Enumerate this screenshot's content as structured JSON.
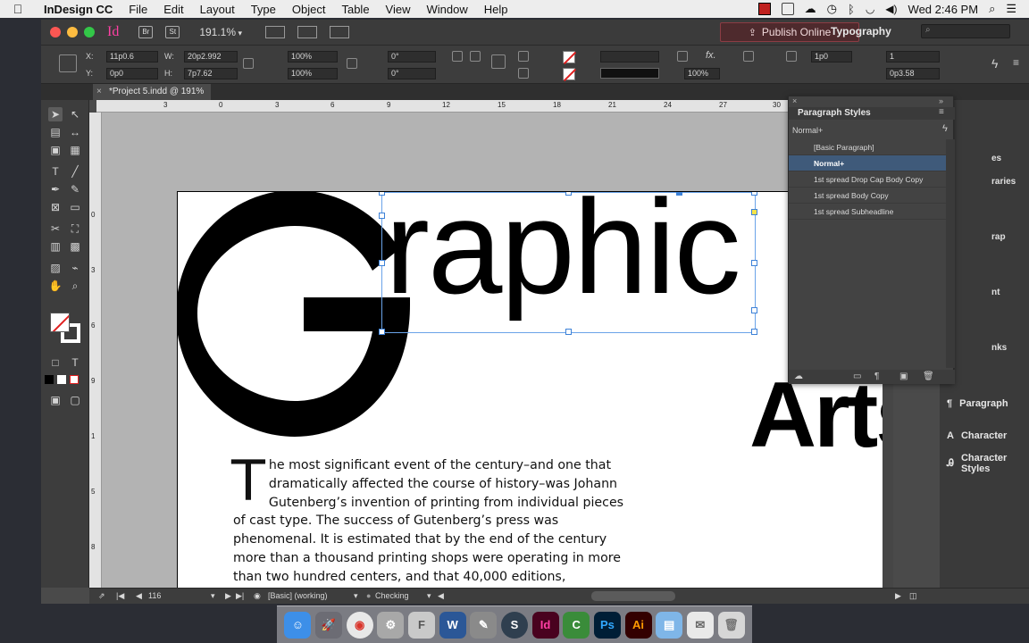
{
  "menubar": {
    "app_name": "InDesign CC",
    "items": [
      "File",
      "Edit",
      "Layout",
      "Type",
      "Object",
      "Table",
      "View",
      "Window",
      "Help"
    ],
    "clock": "Wed 2:46 PM"
  },
  "titlebar": {
    "zoom": "191.1%",
    "publish_label": "Publish Online",
    "workspace": "Typography",
    "btn_br": "Br",
    "btn_st": "St",
    "app_logo": "Id"
  },
  "control": {
    "x_label": "X:",
    "x_value": "11p0.6",
    "y_label": "Y:",
    "y_value": "0p0",
    "w_label": "W:",
    "w_value": "20p2.992",
    "h_label": "H:",
    "h_value": "7p7.62",
    "scale_x": "100%",
    "scale_y": "100%",
    "rotate": "0°",
    "shear": "0°",
    "stroke_weight": "1p0",
    "opacity": "100%",
    "columns": "1",
    "gutter": "0p3.58"
  },
  "document": {
    "tab_title": "*Project 5.indd @ 191%",
    "headline_rest": "raphic",
    "arts": "Arts",
    "dropcap": "T",
    "body": "he most significant event of the century–and one that dramatically affected the course of history–was Johann Gutenberg’s invention of printing from individual pieces of cast type. The success of Gutenberg’s press was phenomenal. It is estimated that by the end of the century more than a thousand printing shops were operating in more than two hundred centers, and that 40,000 editions,"
  },
  "rulers": {
    "top": [
      "3",
      "0",
      "3",
      "6",
      "9",
      "12",
      "15",
      "18",
      "21",
      "24",
      "27",
      "30"
    ],
    "left": [
      "0",
      "3",
      "6",
      "9",
      "1",
      "5",
      "8"
    ]
  },
  "paragraph_styles": {
    "title": "Paragraph Styles",
    "current": "Normal+",
    "items": [
      "[Basic Paragraph]",
      "Normal+",
      "1st spread Drop Cap Body Copy",
      "1st spread Body Copy",
      "1st spread Subheadline"
    ]
  },
  "dock_panels": {
    "fragments": [
      "es",
      "raries",
      "rap",
      "nt",
      "nks"
    ],
    "paragraph": "Paragraph",
    "character": "Character",
    "character_styles": "Character Styles"
  },
  "statusbar": {
    "page": "116",
    "master": "[Basic] (working)",
    "preflight": "Checking"
  },
  "colors": {
    "accent": "#3d82d8",
    "indesign_pink": "#ff3fa4",
    "publish_bg": "#4e2a2d"
  }
}
